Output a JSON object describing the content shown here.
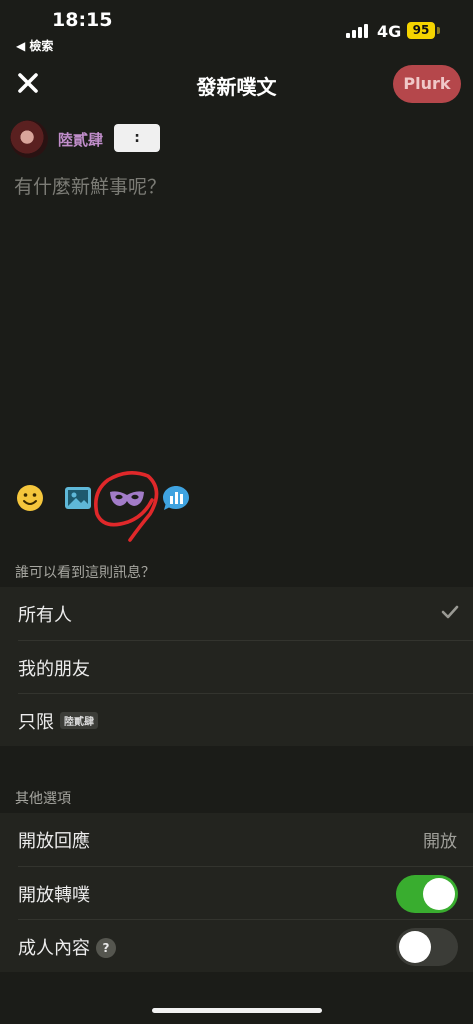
{
  "status_bar": {
    "time": "18:15",
    "back_app": "◀ 檢索",
    "network": "4G",
    "battery": "95"
  },
  "nav": {
    "title": "發新噗文",
    "submit_label": "Plurk",
    "close_icon": "close-icon"
  },
  "compose": {
    "author_name": "陸貳肆",
    "qualifier": ":",
    "placeholder": "有什麼新鮮事呢？"
  },
  "toolbar": {
    "icons": [
      "emoji-icon",
      "image-icon",
      "anonymous-mask-icon",
      "poll-icon"
    ],
    "colors": {
      "emoji": "#f5c63c",
      "image": "#5fb8d8",
      "mask": "#a27cc8",
      "poll": "#3fa3e0",
      "annotation": "#e0282a"
    }
  },
  "visibility": {
    "header": "誰可以看到這則訊息？",
    "options": [
      {
        "label": "所有人",
        "selected": true
      },
      {
        "label": "我的朋友",
        "selected": false
      },
      {
        "label": "只限",
        "chip": "陸貳肆",
        "selected": false
      }
    ]
  },
  "other_options": {
    "header": "其他選項",
    "open_responses": {
      "label": "開放回應",
      "value": "開放"
    },
    "allow_replurk": {
      "label": "開放轉噗",
      "enabled": true
    },
    "adult_content": {
      "label": "成人內容",
      "help": "?",
      "enabled": false
    }
  }
}
